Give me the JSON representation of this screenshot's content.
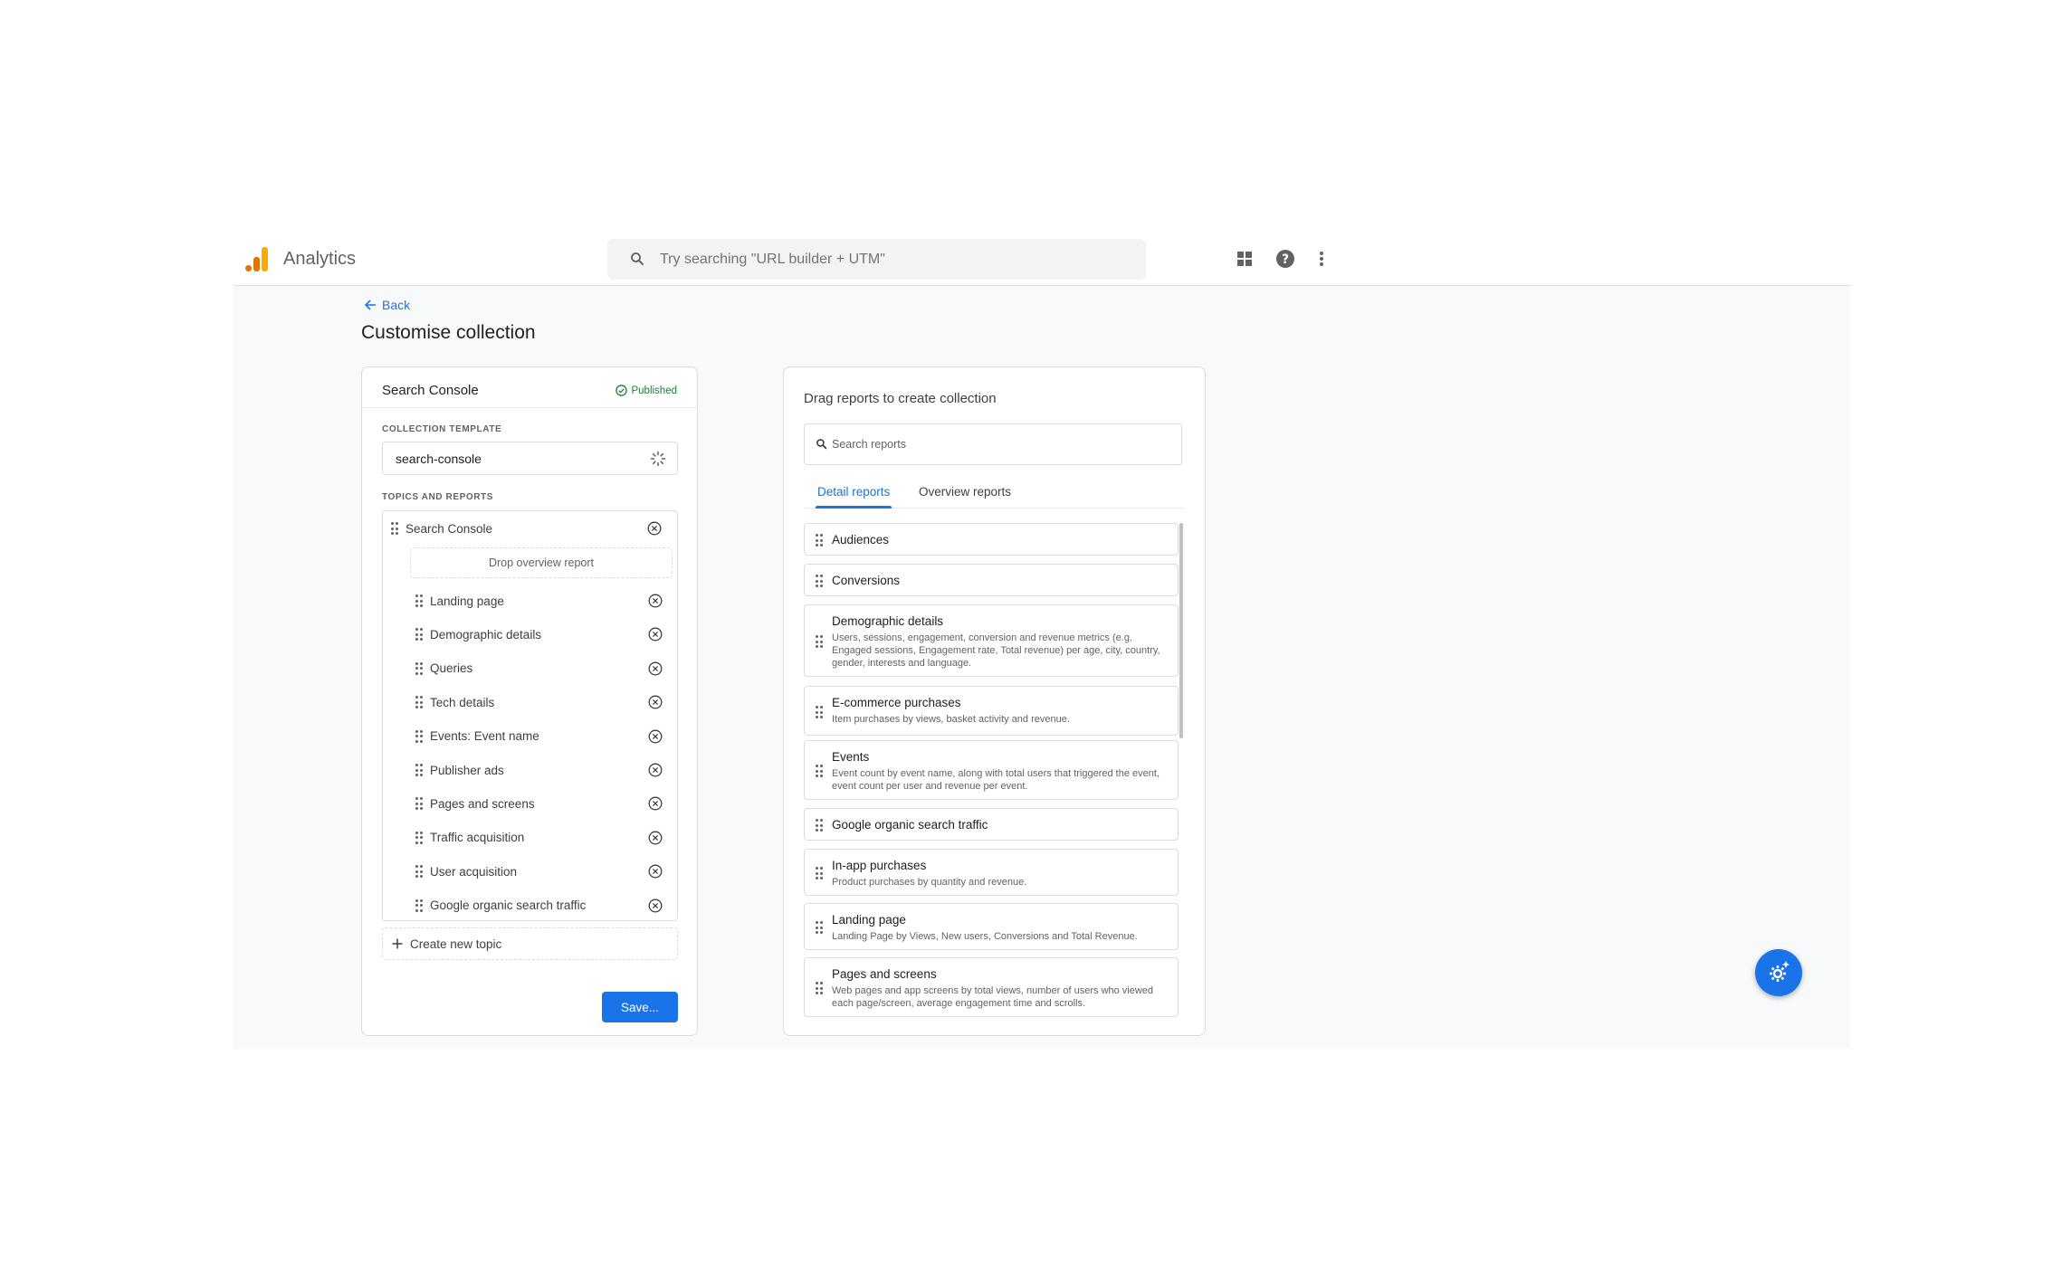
{
  "app": {
    "title": "Analytics"
  },
  "search": {
    "placeholder": "Try searching \"URL builder + UTM\""
  },
  "header": {
    "back_label": "Back",
    "page_title": "Customise collection"
  },
  "left_card": {
    "collection_name": "Search Console",
    "status": "Published",
    "template_label": "COLLECTION TEMPLATE",
    "template_value": "search-console",
    "topics_label": "TOPICS AND REPORTS",
    "topic": {
      "name": "Search Console",
      "drop_zone": "Drop overview report",
      "reports": [
        "Landing page",
        "Demographic details",
        "Queries",
        "Tech details",
        "Events: Event name",
        "Publisher ads",
        "Pages and screens",
        "Traffic acquisition",
        "User acquisition",
        "Google organic search traffic"
      ]
    },
    "create_topic_label": "Create new topic",
    "save_label": "Save..."
  },
  "right_card": {
    "title": "Drag reports to create collection",
    "search_placeholder": "Search reports",
    "tabs": [
      {
        "label": "Detail reports",
        "active": true
      },
      {
        "label": "Overview reports",
        "active": false
      }
    ],
    "reports": [
      {
        "title": "Audiences",
        "desc": ""
      },
      {
        "title": "Conversions",
        "desc": ""
      },
      {
        "title": "Demographic details",
        "desc": "Users, sessions, engagement, conversion and revenue metrics (e.g. Engaged sessions, Engagement rate, Total revenue) per age, city, country, gender, interests and language."
      },
      {
        "title": "E-commerce purchases",
        "desc": "Item purchases by views, basket activity and revenue."
      },
      {
        "title": "Events",
        "desc": "Event count by event name, along with total users that triggered the event, event count per user and revenue per event."
      },
      {
        "title": "Google organic search traffic",
        "desc": ""
      },
      {
        "title": "In-app purchases",
        "desc": "Product purchases by quantity and revenue."
      },
      {
        "title": "Landing page",
        "desc": "Landing Page by Views, New users, Conversions and Total Revenue."
      },
      {
        "title": "Pages and screens",
        "desc": "Web pages and app screens by total views, number of users who viewed each page/screen, average engagement time and scrolls."
      }
    ]
  },
  "colors": {
    "accent": "#1a73e8",
    "published": "#188038",
    "logo_orange": "#e37400",
    "logo_yellow": "#f9ab00"
  }
}
